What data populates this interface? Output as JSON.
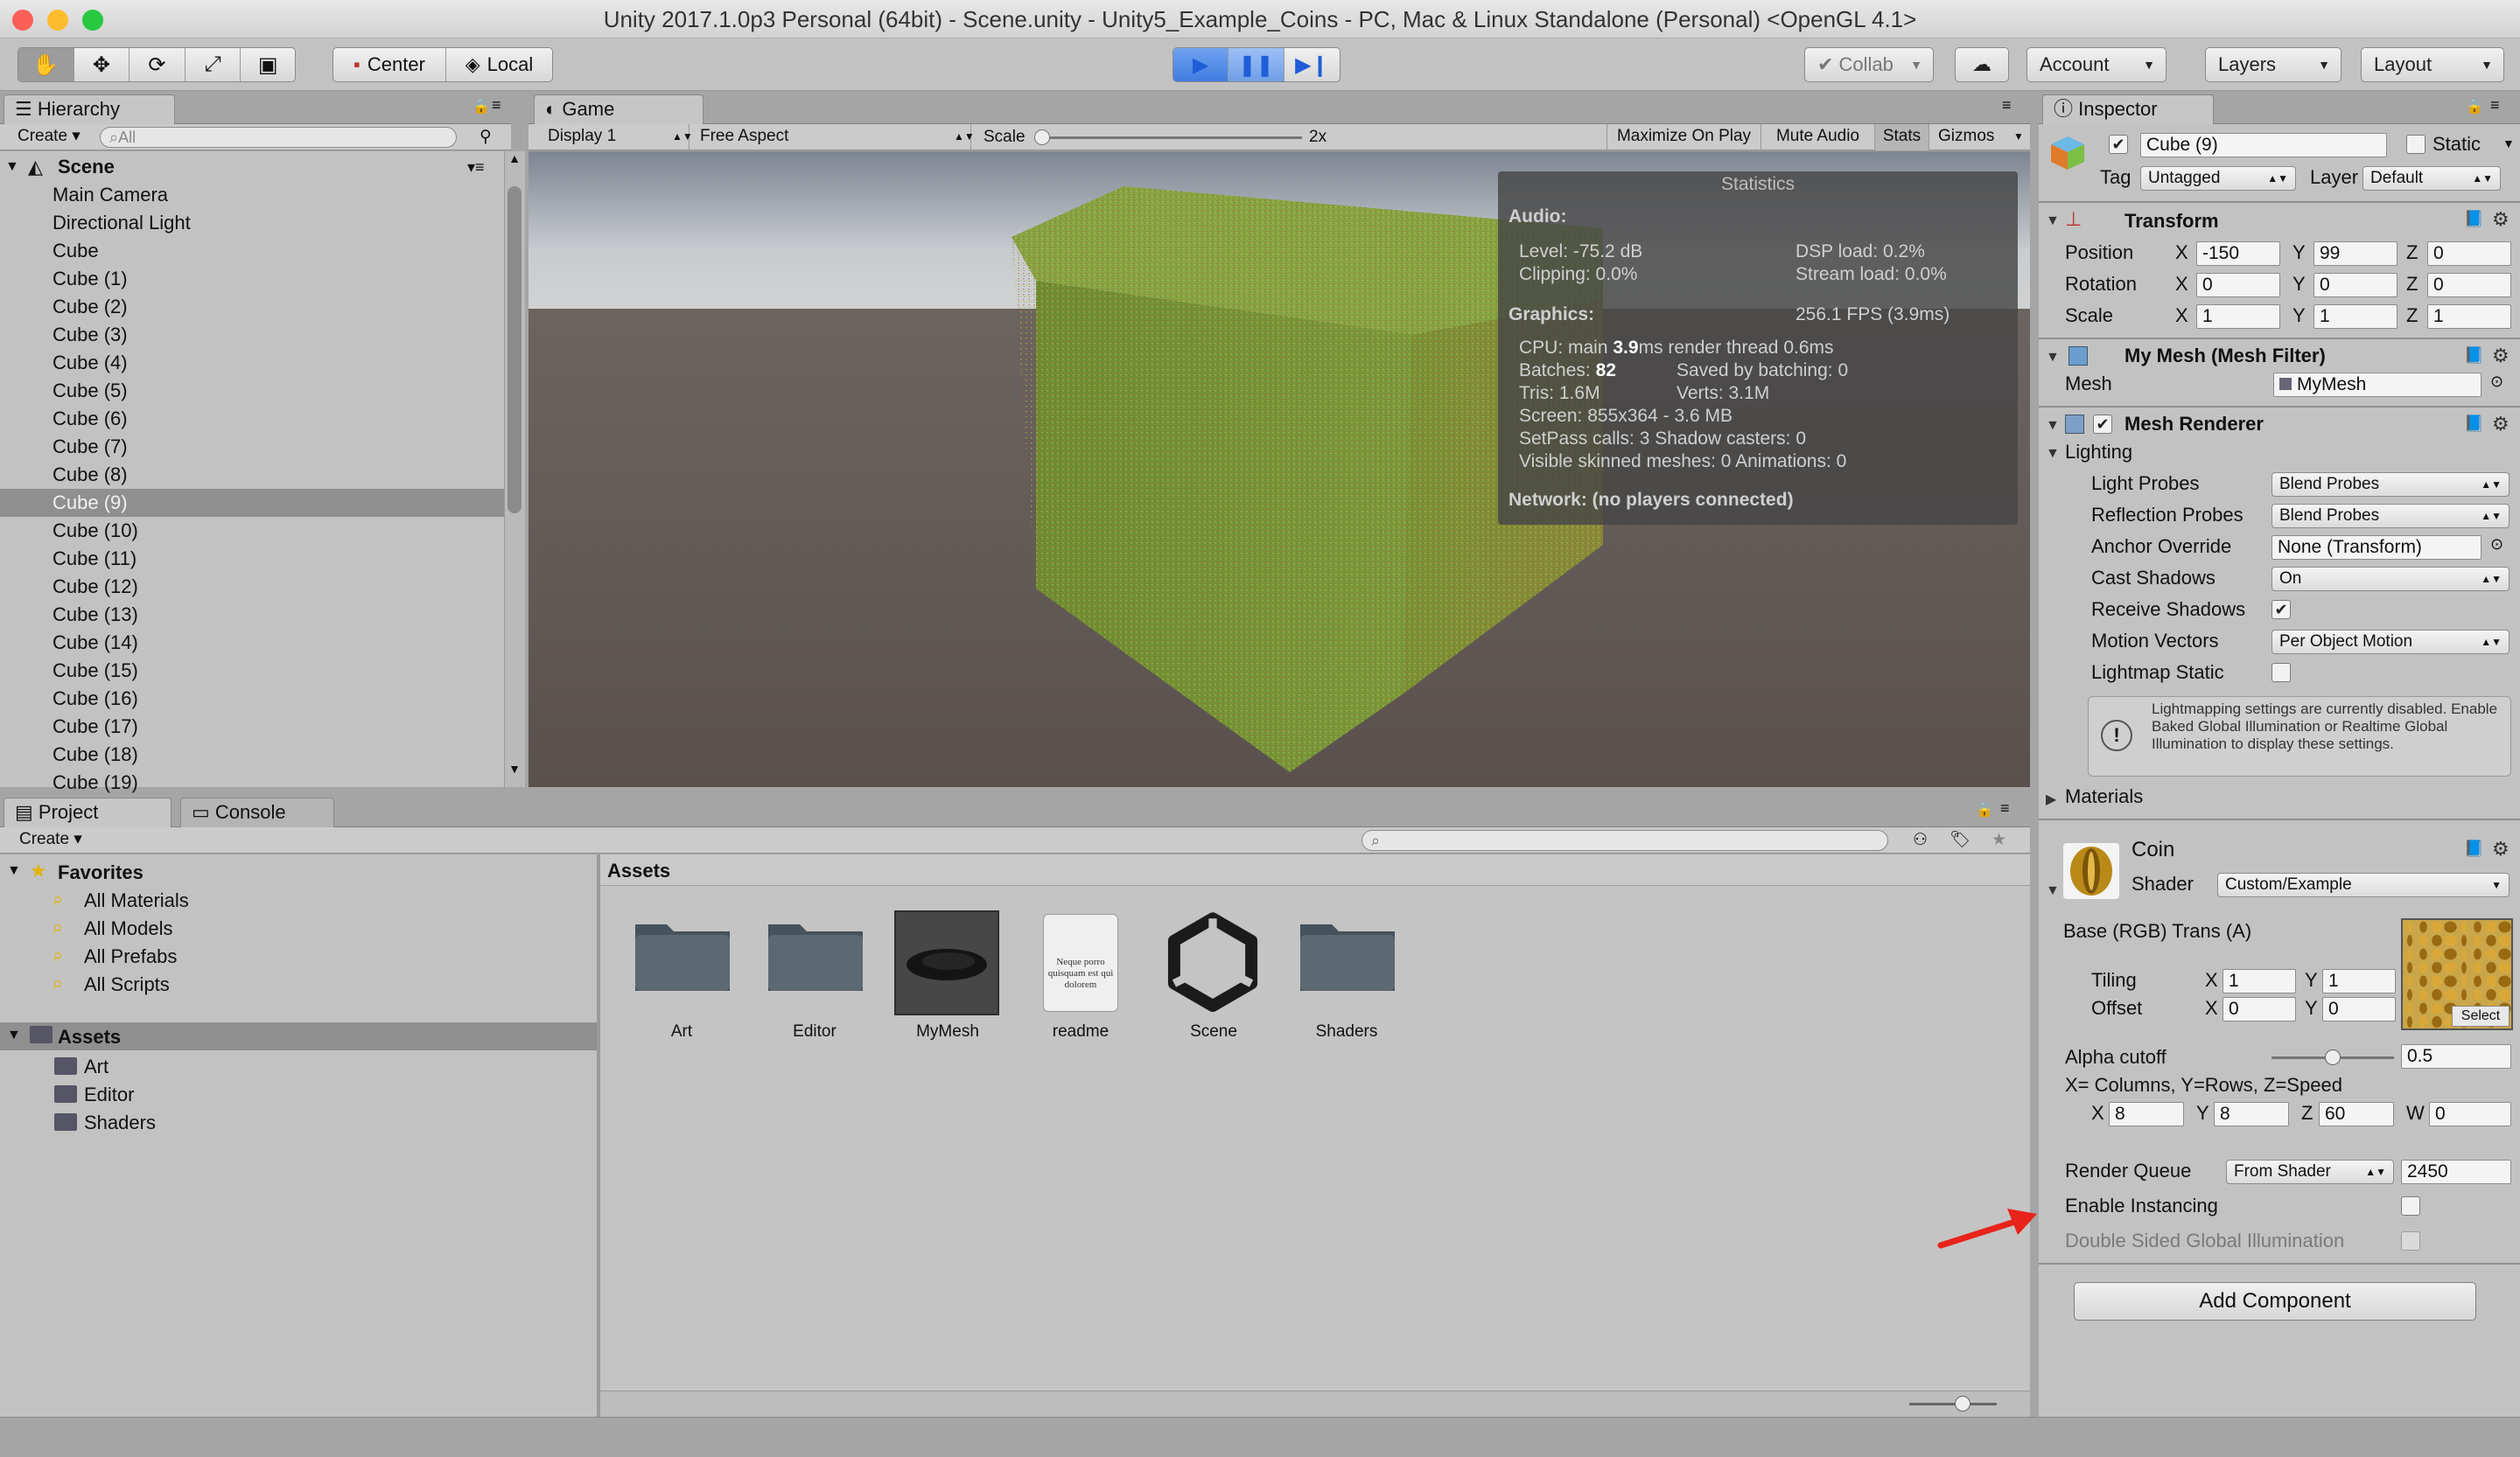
{
  "window": {
    "title": "Unity 2017.1.0p3 Personal (64bit) - Scene.unity - Unity5_Example_Coins - PC, Mac & Linux Standalone (Personal) <OpenGL 4.1>"
  },
  "toolbar": {
    "pivot": "Center",
    "space": "Local",
    "collab": "Collab",
    "account": "Account",
    "layers": "Layers",
    "layout": "Layout"
  },
  "hierarchy": {
    "tab": "Hierarchy",
    "create": "Create",
    "search_placeholder": "All",
    "scene": "Scene",
    "items": [
      "Main Camera",
      "Directional Light",
      "Cube",
      "Cube (1)",
      "Cube (2)",
      "Cube (3)",
      "Cube (4)",
      "Cube (5)",
      "Cube (6)",
      "Cube (7)",
      "Cube (8)",
      "Cube (9)",
      "Cube (10)",
      "Cube (11)",
      "Cube (12)",
      "Cube (13)",
      "Cube (14)",
      "Cube (15)",
      "Cube (16)",
      "Cube (17)",
      "Cube (18)",
      "Cube (19)"
    ],
    "selected": "Cube (9)"
  },
  "game": {
    "tab": "Game",
    "display": "Display 1",
    "aspect": "Free Aspect",
    "scale_label": "Scale",
    "scale_value": "2x",
    "maximize": "Maximize On Play",
    "mute": "Mute Audio",
    "stats": "Stats",
    "gizmos": "Gizmos"
  },
  "statistics": {
    "title": "Statistics",
    "audio_label": "Audio:",
    "level": "Level: -75.2 dB",
    "clipping": "Clipping: 0.0%",
    "dsp": "DSP load: 0.2%",
    "stream": "Stream load: 0.0%",
    "graphics_label": "Graphics:",
    "fps": "256.1 FPS (3.9ms)",
    "cpu_prefix": "CPU: main",
    "cpu_value": "3.9",
    "cpu_suffix": "ms  render thread 0.6ms",
    "batches_prefix": "Batches:",
    "batches_value": "82",
    "saved": "Saved by batching: 0",
    "tris": "Tris: 1.6M",
    "verts": "Verts: 3.1M",
    "screen": "Screen: 855x364 - 3.6 MB",
    "setpass": "SetPass calls: 3   Shadow casters: 0",
    "skinned": "Visible skinned meshes: 0  Animations: 0",
    "network": "Network: (no players connected)"
  },
  "project": {
    "tab_project": "Project",
    "tab_console": "Console",
    "create": "Create",
    "favorites_label": "Favorites",
    "favorites": [
      "All Materials",
      "All Models",
      "All Prefabs",
      "All Scripts"
    ],
    "assets_root": "Assets",
    "asset_folders": [
      "Art",
      "Editor",
      "Shaders"
    ],
    "breadcrumb": "Assets",
    "assets": [
      "Art",
      "Editor",
      "MyMesh",
      "readme",
      "Scene",
      "Shaders"
    ],
    "readme_preview": "Neque porro quisquam est qui dolorem"
  },
  "inspector": {
    "tab": "Inspector",
    "object_name": "Cube (9)",
    "static": "Static",
    "tag_label": "Tag",
    "tag_value": "Untagged",
    "layer_label": "Layer",
    "layer_value": "Default",
    "transform": {
      "title": "Transform",
      "position_label": "Position",
      "position": {
        "x": "-150",
        "y": "99",
        "z": "0"
      },
      "rotation_label": "Rotation",
      "rotation": {
        "x": "0",
        "y": "0",
        "z": "0"
      },
      "scale_label": "Scale",
      "scale": {
        "x": "1",
        "y": "1",
        "z": "1"
      }
    },
    "mesh_filter": {
      "title": "My Mesh (Mesh Filter)",
      "mesh_label": "Mesh",
      "mesh_value": "MyMesh"
    },
    "mesh_renderer": {
      "title": "Mesh Renderer",
      "lighting": "Lighting",
      "light_probes_label": "Light Probes",
      "light_probes": "Blend Probes",
      "reflection_probes_label": "Reflection Probes",
      "reflection_probes": "Blend Probes",
      "anchor_label": "Anchor Override",
      "anchor": "None (Transform)",
      "cast_label": "Cast Shadows",
      "cast": "On",
      "receive_label": "Receive Shadows",
      "motion_label": "Motion Vectors",
      "motion": "Per Object Motion",
      "lightmap_label": "Lightmap Static",
      "help": "Lightmapping settings are currently disabled. Enable Baked Global Illumination or Realtime Global Illumination to display these settings.",
      "materials": "Materials"
    },
    "material": {
      "name": "Coin",
      "shader_label": "Shader",
      "shader": "Custom/Example",
      "base_label": "Base (RGB) Trans (A)",
      "tiling_label": "Tiling",
      "tiling": {
        "x": "1",
        "y": "1"
      },
      "offset_label": "Offset",
      "offset": {
        "x": "0",
        "y": "0"
      },
      "select": "Select",
      "alpha_label": "Alpha cutoff",
      "alpha_value": "0.5",
      "alpha_fraction": 0.5,
      "vector_label": "X= Columns, Y=Rows, Z=Speed",
      "vector": {
        "x": "8",
        "y": "8",
        "z": "60",
        "w": "0"
      },
      "queue_label": "Render Queue",
      "queue_mode": "From Shader",
      "queue_value": "2450",
      "instancing_label": "Enable Instancing",
      "double_sided_label": "Double Sided Global Illumination"
    },
    "add_component": "Add Component"
  },
  "colors": {
    "accent": "#3f7de0",
    "selection": "#8f8f8f",
    "arrow": "#e8231a"
  }
}
